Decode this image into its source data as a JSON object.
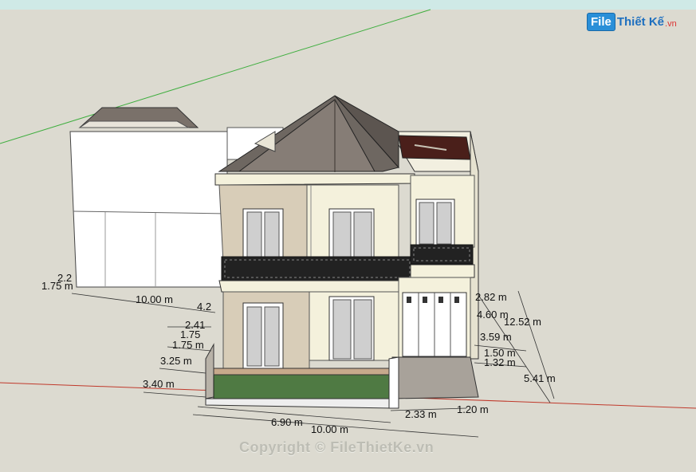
{
  "watermark": {
    "logo_badge": "File",
    "logo_text": "Thiết Kế",
    "logo_tld": ".vn",
    "copyright": "Copyright © FileThietKe.vn"
  },
  "dimensions": {
    "left_building": [
      "2.2",
      "1.75 m",
      "10.00 m"
    ],
    "left_stack": [
      "4.2",
      "2.41",
      "1.75",
      "1.75 m",
      "3.25 m",
      "3.40 m"
    ],
    "right_stack": [
      "2.82 m",
      "4.60 m",
      "12.52 m",
      "3.59 m",
      "1.50 m",
      "1.32 m",
      "5.41 m"
    ],
    "bottom": [
      "6.90 m",
      "2.33 m",
      "1.20 m",
      "10.00 m"
    ]
  },
  "colors": {
    "ground": "#dcdad0",
    "sky": "#cfe9e6",
    "roof": "#6e6761",
    "wall_cream": "#f4f1dc",
    "wall_tan": "#d8cdb8",
    "railing": "#222222",
    "lawn": "#4f7a43",
    "axis_red": "#c0392b",
    "axis_green": "#3fae3f"
  }
}
